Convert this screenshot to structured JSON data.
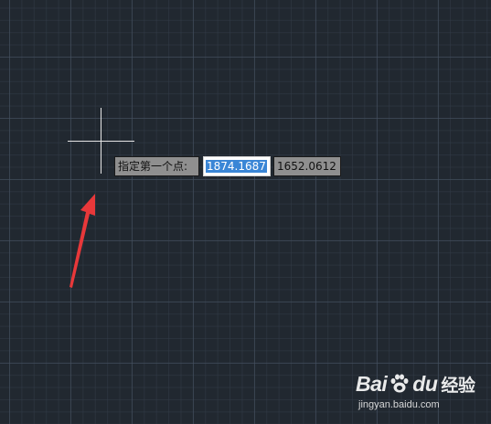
{
  "cad": {
    "dynamic_input": {
      "prompt": "指定第一个点:",
      "x_value": "1874.1687",
      "y_value": "1652.0612"
    }
  },
  "watermark": {
    "brand": "Bai",
    "brand_suffix": "du",
    "service": "经验",
    "url": "jingyan.baidu.com"
  },
  "colors": {
    "canvas_background": "#212830",
    "crosshair": "#e6e6e6",
    "annotation_arrow": "#e8383a",
    "input_highlight": "#3a86d6"
  },
  "icons": {
    "cursor": "crosshair-icon",
    "annotation": "red-arrow-icon",
    "watermark_logo": "baidu-paw-icon"
  }
}
